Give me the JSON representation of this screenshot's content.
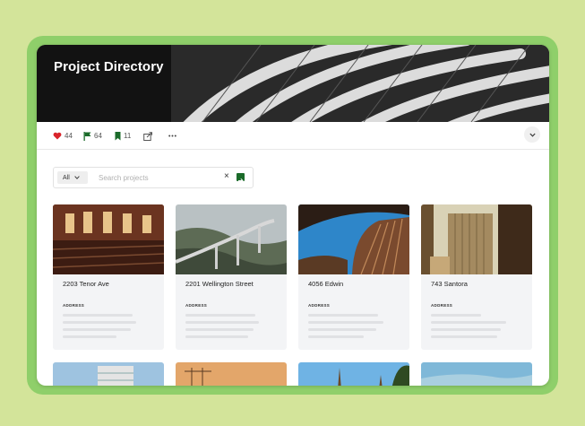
{
  "app": {
    "title": "Project Directory"
  },
  "actions": {
    "likes": "44",
    "flags": "64",
    "bookmarks": "11"
  },
  "search": {
    "filter": "All",
    "placeholder": "Search projects",
    "clear": "×"
  },
  "cards": [
    {
      "name": "2203 Tenor Ave",
      "label": "ADDRESS"
    },
    {
      "name": "2201 Wellington Street",
      "label": "ADDRESS"
    },
    {
      "name": "4056 Edwin",
      "label": "ADDRESS"
    },
    {
      "name": "743 Santora",
      "label": "ADDRESS"
    }
  ],
  "colors": {
    "accent": "#1b6b2a",
    "heart": "#d9252b",
    "frame": "#8fcf6a",
    "background": "#d3e49a"
  },
  "icons": [
    "heart-icon",
    "flag-icon",
    "bookmark-icon",
    "share-icon",
    "more-icon",
    "chevron-down-icon",
    "close-icon",
    "arrow-right-icon"
  ]
}
